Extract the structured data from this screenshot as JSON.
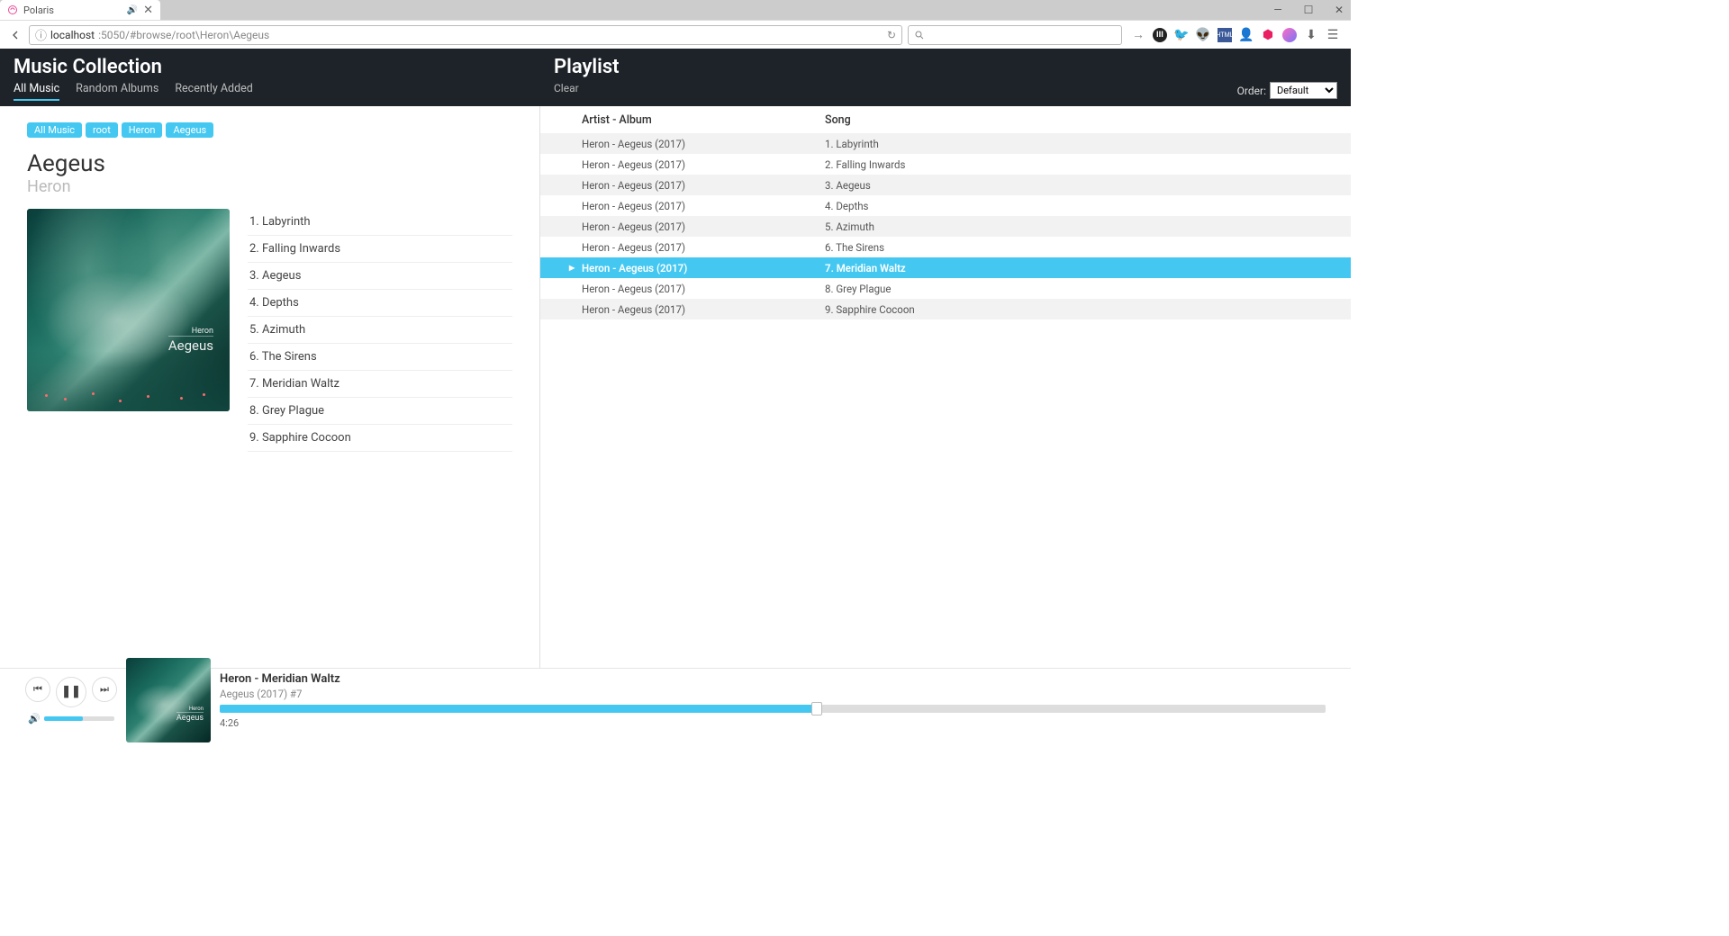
{
  "browser": {
    "tab_title": "Polaris",
    "url_host": "localhost",
    "url_path": ":5050/#browse/root\\Heron\\Aegeus"
  },
  "header": {
    "left_title": "Music Collection",
    "nav": [
      "All Music",
      "Random Albums",
      "Recently Added"
    ],
    "right_title": "Playlist",
    "clear": "Clear",
    "order_label": "Order:",
    "order_value": "Default"
  },
  "breadcrumbs": [
    "All Music",
    "root",
    "Heron",
    "Aegeus"
  ],
  "album": {
    "title": "Aegeus",
    "artist": "Heron",
    "cover_artist": "Heron",
    "cover_title": "Aegeus",
    "tracks": [
      "1. Labyrinth",
      "2. Falling Inwards",
      "3. Aegeus",
      "4. Depths",
      "5. Azimuth",
      "6. The Sirens",
      "7. Meridian Waltz",
      "8. Grey Plague",
      "9. Sapphire Cocoon"
    ]
  },
  "playlist": {
    "col_artist": "Artist - Album",
    "col_song": "Song",
    "rows": [
      {
        "artist": "Heron - Aegeus (2017)",
        "song": "1. Labyrinth"
      },
      {
        "artist": "Heron - Aegeus (2017)",
        "song": "2. Falling Inwards"
      },
      {
        "artist": "Heron - Aegeus (2017)",
        "song": "3. Aegeus"
      },
      {
        "artist": "Heron - Aegeus (2017)",
        "song": "4. Depths"
      },
      {
        "artist": "Heron - Aegeus (2017)",
        "song": "5. Azimuth"
      },
      {
        "artist": "Heron - Aegeus (2017)",
        "song": "6. The Sirens"
      },
      {
        "artist": "Heron - Aegeus (2017)",
        "song": "7. Meridian Waltz"
      },
      {
        "artist": "Heron - Aegeus (2017)",
        "song": "8. Grey Plague"
      },
      {
        "artist": "Heron - Aegeus (2017)",
        "song": "9. Sapphire Cocoon"
      }
    ],
    "playing_index": 6
  },
  "player": {
    "title": "Heron - Meridian Waltz",
    "subtitle": "Aegeus (2017) #7",
    "time": "4:26"
  }
}
